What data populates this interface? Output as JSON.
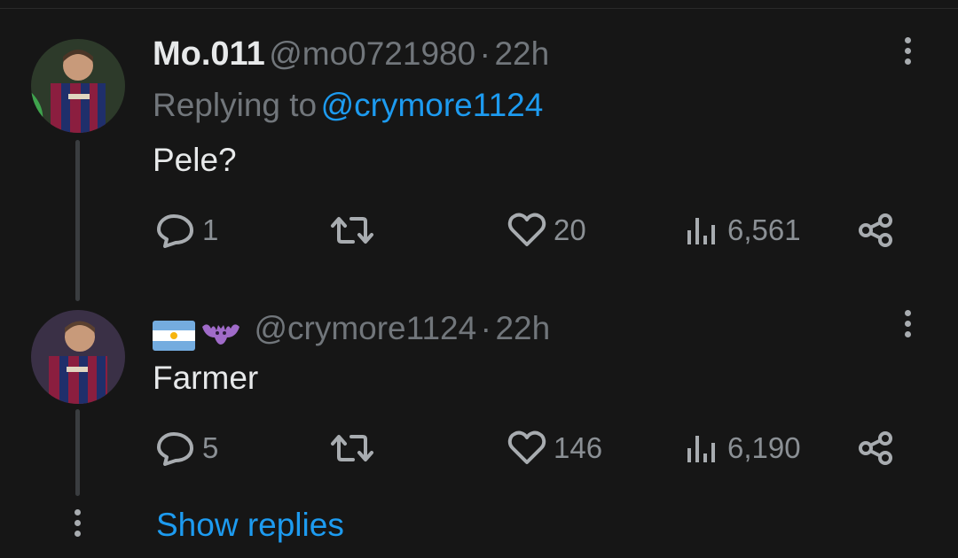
{
  "replies": [
    {
      "display_name": "Mo.011",
      "handle": "@mo0721980",
      "separator": "·",
      "time": "22h",
      "replying_prefix": "Replying to",
      "replying_to": "@crymore1124",
      "text": "Pele?",
      "stats": {
        "replies": "1",
        "retweets": "",
        "likes": "20",
        "views": "6,561"
      }
    },
    {
      "display_name_emoji": "🇦🇷😈",
      "handle": "@crymore1124",
      "separator": "·",
      "time": "22h",
      "text": "Farmer",
      "stats": {
        "replies": "5",
        "retweets": "",
        "likes": "146",
        "views": "6,190"
      }
    }
  ],
  "show_replies_label": "Show replies",
  "colors": {
    "background": "#161616",
    "accent": "#1d9bf0",
    "muted": "#71767b"
  }
}
